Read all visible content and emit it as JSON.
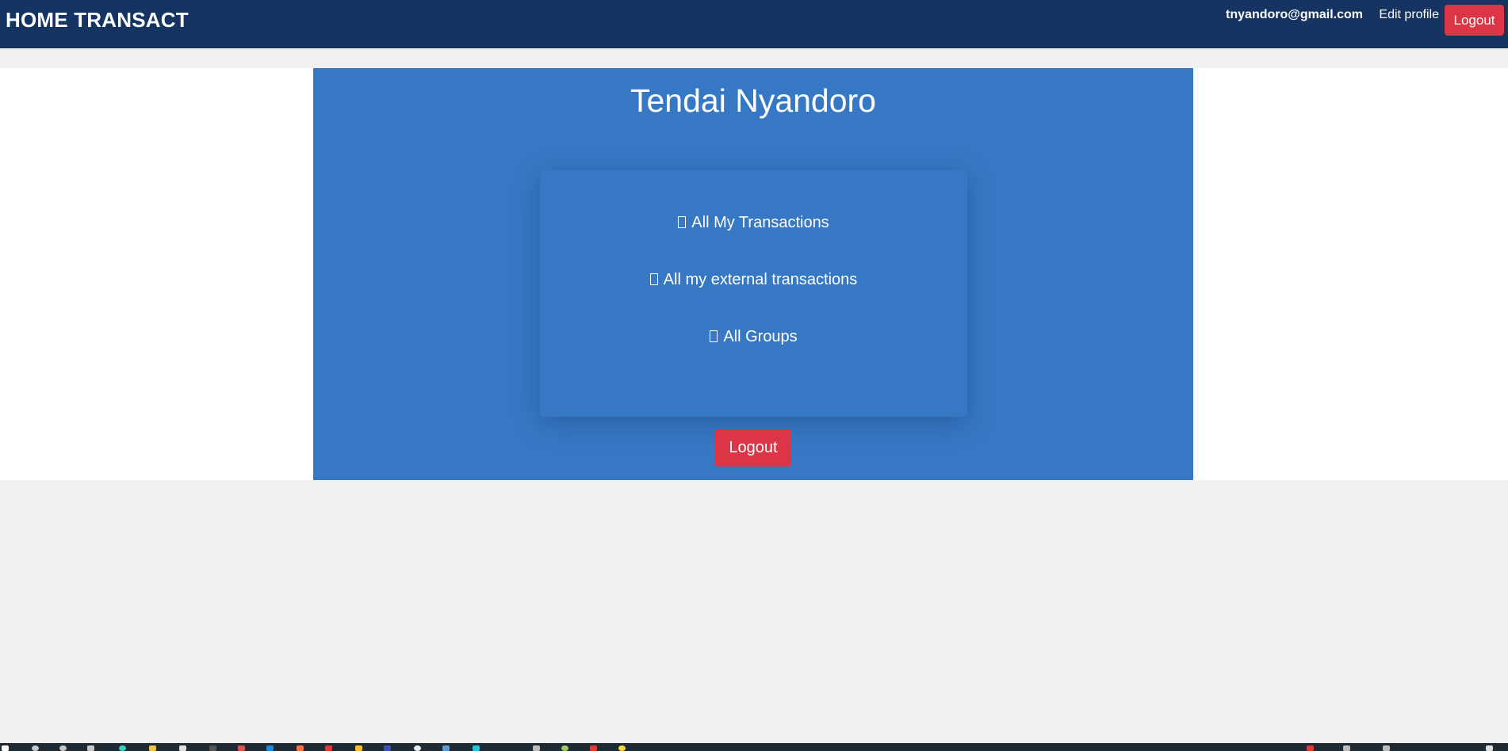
{
  "navbar": {
    "brand": "HOME TRANSACT",
    "email": "tnyandoro@gmail.com",
    "edit_profile": "Edit profile",
    "logout": "Logout"
  },
  "profile": {
    "name": "Tendai Nyandoro",
    "menu": [
      {
        "icon": "list-icon",
        "label": "All My Transactions"
      },
      {
        "icon": "external-icon",
        "label": "All my external transactions"
      },
      {
        "icon": "group-icon",
        "label": "All Groups"
      }
    ],
    "logout": "Logout"
  },
  "colors": {
    "navbar": "#163461",
    "panel": "#3778c4",
    "danger": "#dc3545",
    "background": "#f0f0f0"
  },
  "taskbar": {
    "icons": [
      "start-icon",
      "search-icon",
      "cortana-icon",
      "task-view-icon",
      "browser-icon",
      "folder-icon",
      "app-icon",
      "app-icon",
      "app-icon",
      "app-icon",
      "app-icon",
      "app-icon",
      "app-icon",
      "app-icon",
      "app-icon",
      "app-icon",
      "app-icon",
      "app-icon",
      "app-icon",
      "app-icon"
    ]
  }
}
